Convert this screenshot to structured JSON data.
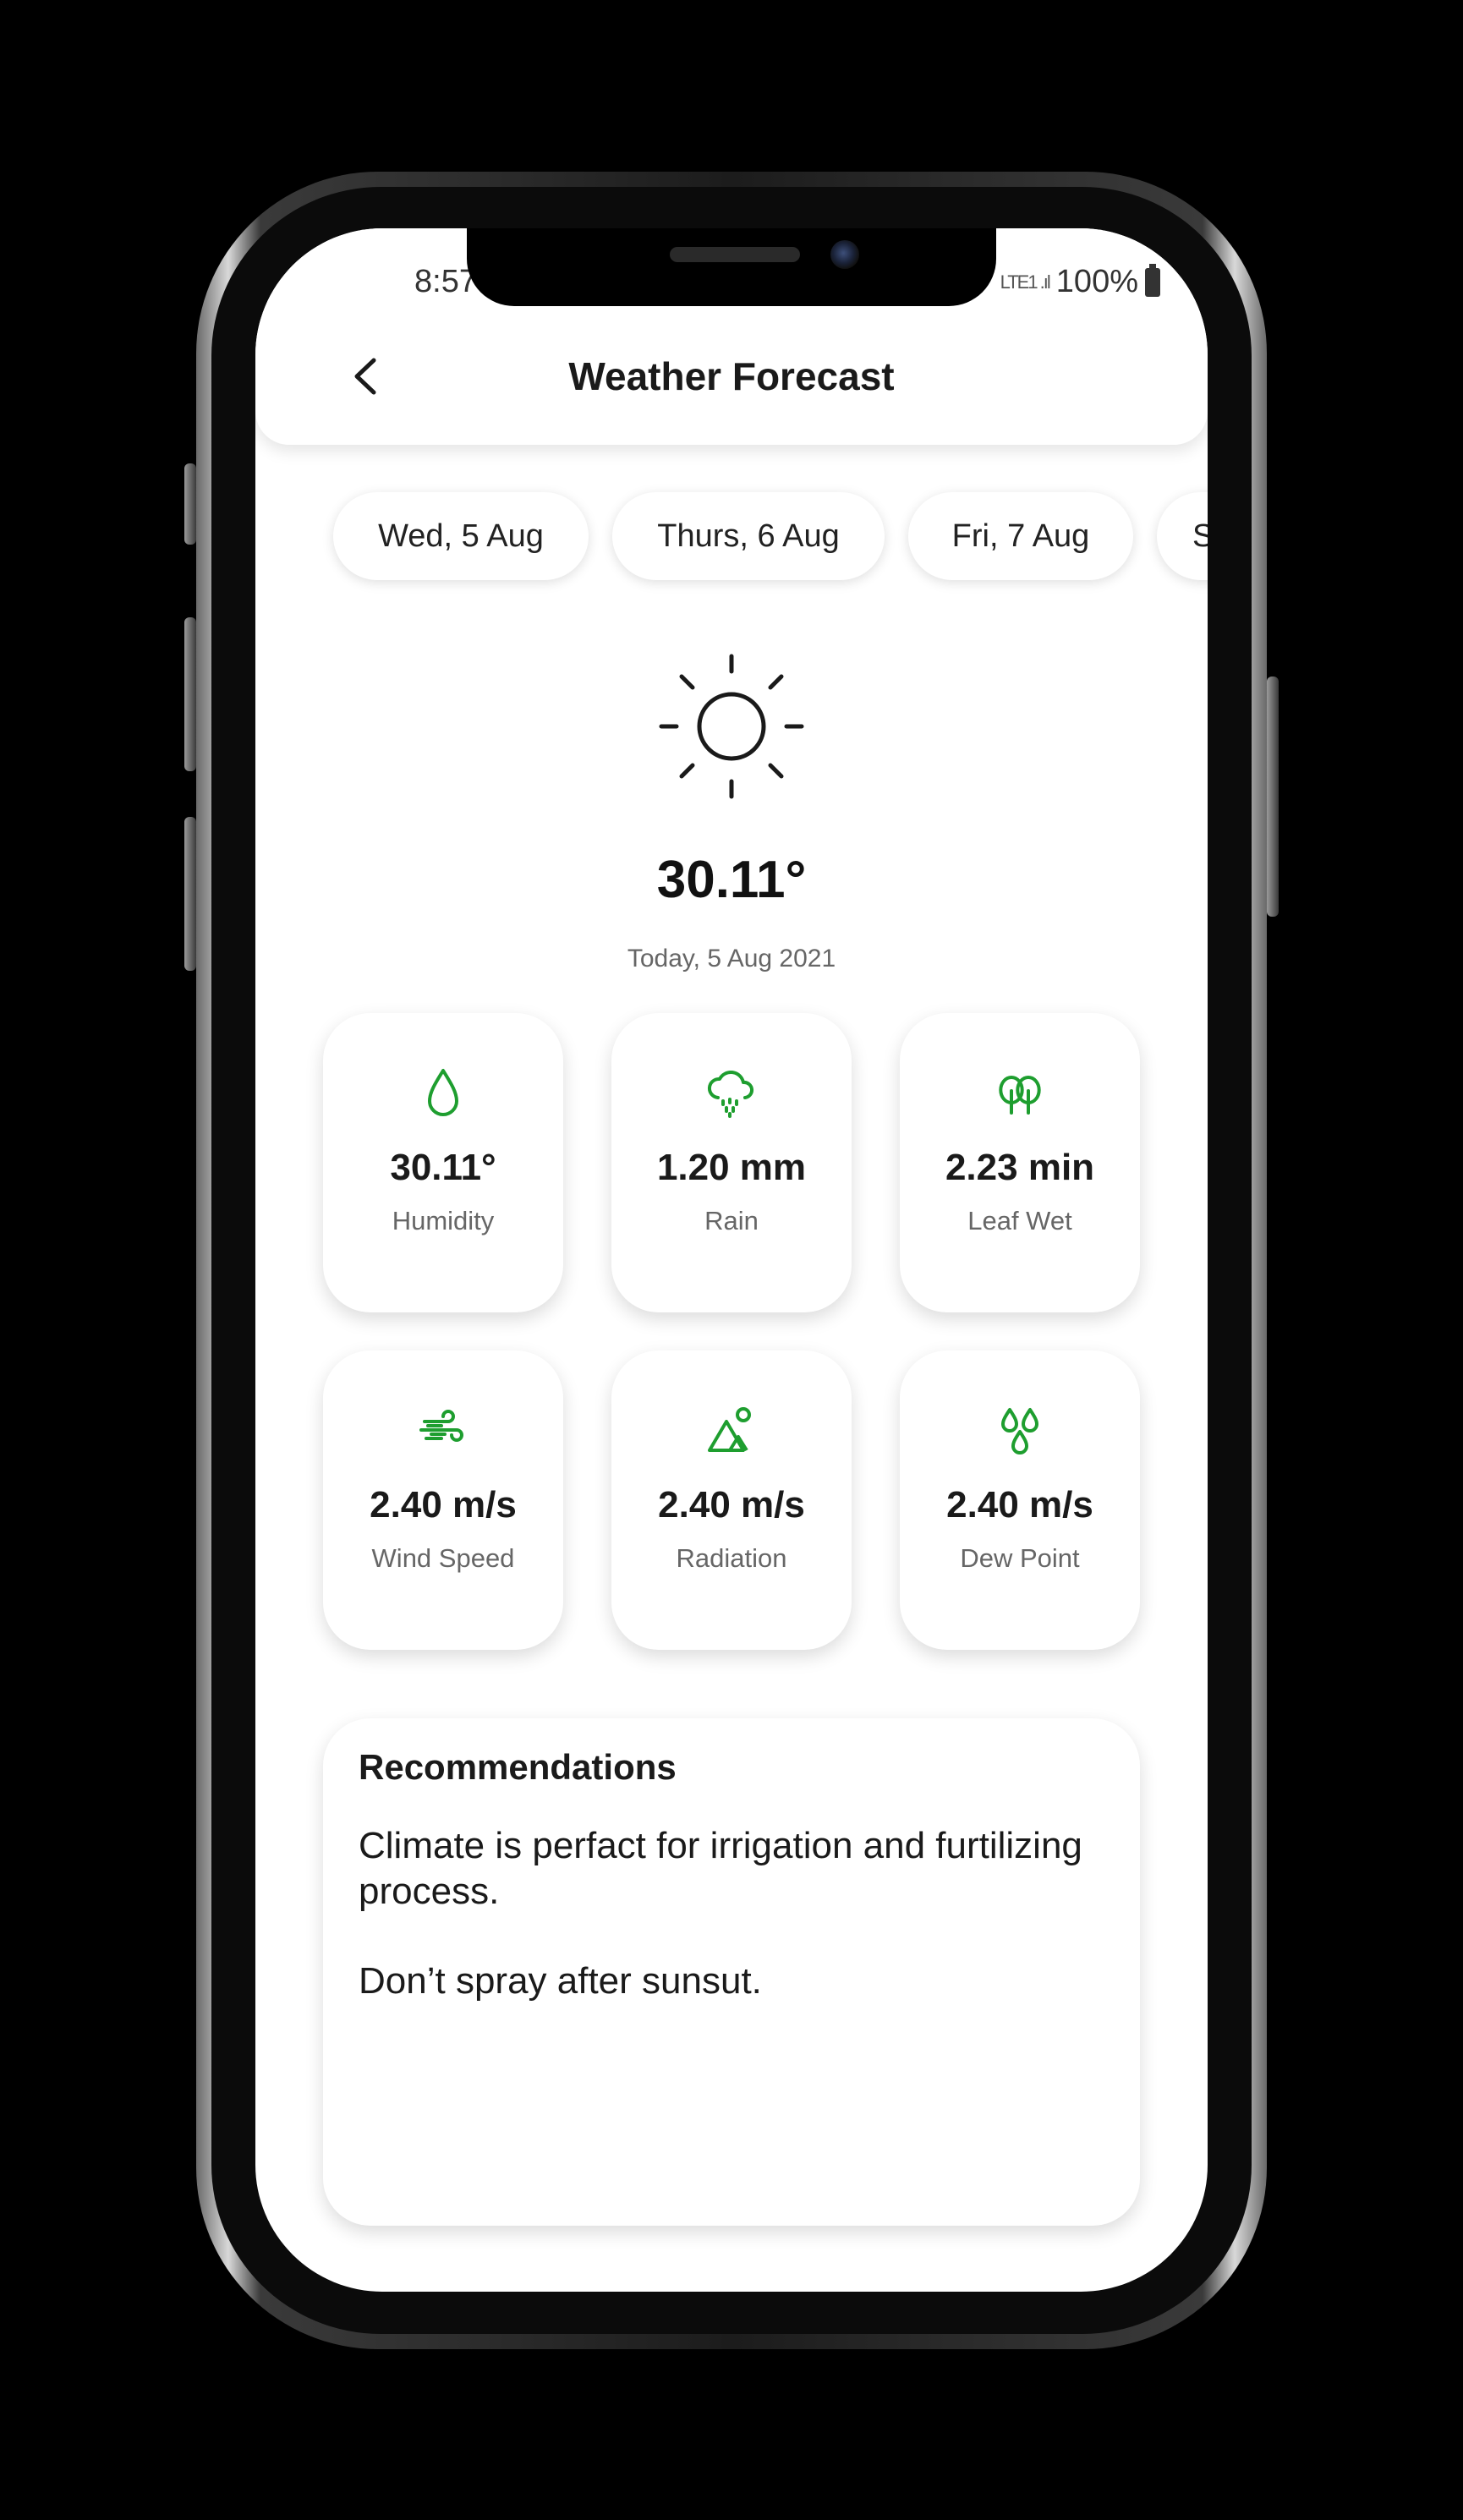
{
  "status": {
    "time": "8:57",
    "network": "LTE1 .ıl",
    "battery": "100%"
  },
  "header": {
    "title": "Weather Forecast"
  },
  "days": [
    {
      "label": "Wed, 5 Aug"
    },
    {
      "label": "Thurs, 6 Aug"
    },
    {
      "label": "Fri, 7 Aug"
    },
    {
      "label": "S"
    }
  ],
  "current": {
    "icon": "sun-icon",
    "temperature": "30.11°",
    "date": "Today, 5 Aug 2021"
  },
  "metrics": [
    {
      "icon": "droplet-icon",
      "value": "30.11°",
      "label": "Humidity"
    },
    {
      "icon": "rain-cloud-icon",
      "value": "1.20 mm",
      "label": "Rain"
    },
    {
      "icon": "trees-icon",
      "value": "2.23 min",
      "label": "Leaf Wet"
    },
    {
      "icon": "wind-icon",
      "value": "2.40 m/s",
      "label": "Wind Speed"
    },
    {
      "icon": "mountain-sun-icon",
      "value": "2.40 m/s",
      "label": "Radiation"
    },
    {
      "icon": "dew-drops-icon",
      "value": "2.40 m/s",
      "label": "Dew Point"
    }
  ],
  "recommendations": {
    "title": "Recommendations",
    "lines": [
      "Climate is perfact for irrigation and furtilizing process.",
      "Don’t spray after sunsut."
    ]
  },
  "colors": {
    "accent": "#1e9e2f",
    "text": "#1a1a1a",
    "muted": "#666666",
    "background": "#ffffff"
  }
}
